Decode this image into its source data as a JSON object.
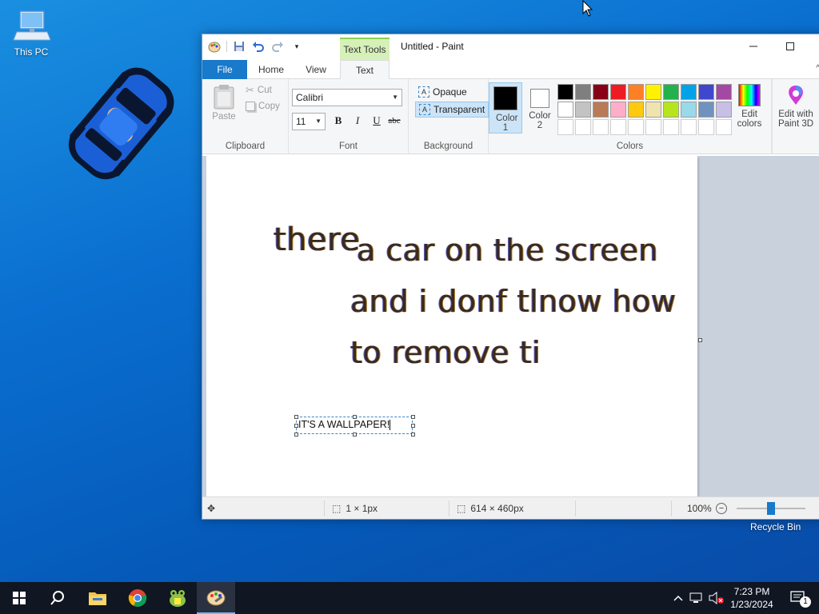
{
  "desktop": {
    "this_pc_label": "This PC",
    "recycle_bin_label": "Recycle Bin"
  },
  "paint": {
    "window_title": "Untitled - Paint",
    "contextual_tab": "Text Tools",
    "tabs": [
      {
        "label": "File"
      },
      {
        "label": "Home"
      },
      {
        "label": "View"
      },
      {
        "label": "Text"
      }
    ],
    "clipboard": {
      "paste": "Paste",
      "cut": "Cut",
      "copy": "Copy",
      "group": "Clipboard"
    },
    "font": {
      "family": "Calibri",
      "size": "11",
      "bold": "B",
      "italic": "I",
      "underline": "U",
      "strike": "abc",
      "group": "Font"
    },
    "background": {
      "opaque": "Opaque",
      "transparent": "Transparent",
      "group": "Background"
    },
    "colors": {
      "color1": "Color 1",
      "color2": "Color 2",
      "edit": "Edit colors",
      "group": "Colors",
      "color1_value": "#000000",
      "color2_value": "#ffffff",
      "palette_row1": [
        "#000000",
        "#7f7f7f",
        "#880015",
        "#ed1c24",
        "#ff7f27",
        "#fff200",
        "#22b14c",
        "#00a2e8",
        "#3f48cc",
        "#a349a4"
      ],
      "palette_row2": [
        "#ffffff",
        "#c3c3c3",
        "#b97a57",
        "#ffaec9",
        "#ffc90e",
        "#efe4b0",
        "#b5e61d",
        "#99d9ea",
        "#7092be",
        "#c8bfe7"
      ]
    },
    "paint3d": "Edit with Paint 3D",
    "canvas_text": {
      "line1a": "there",
      "line1b": "a car on the screen",
      "line2": "and i donf tlnow how",
      "line3": "to remove ti",
      "textbox": "IT'S A WALLPAPER!"
    },
    "status": {
      "selection": "1 × 1px",
      "size": "614 × 460px",
      "zoom": "100%"
    }
  },
  "taskbar": {
    "time": "7:23 PM",
    "date": "1/23/2024",
    "notif_count": "1"
  }
}
